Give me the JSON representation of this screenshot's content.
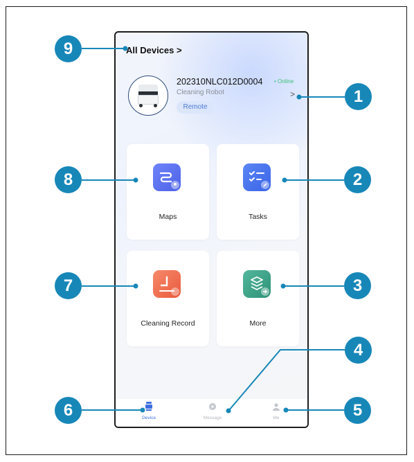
{
  "header": {
    "all_devices_label": "All Devices >"
  },
  "device": {
    "name": "202310NLC012D0004",
    "status": "• Online",
    "type": "Cleaning Robot",
    "remote_label": "Remote",
    "chevron": ">"
  },
  "cards": [
    {
      "label": "Maps",
      "icon": "map-route-icon",
      "color": "#5b6ef0"
    },
    {
      "label": "Tasks",
      "icon": "task-list-icon",
      "color": "#4a75ee"
    },
    {
      "label": "Cleaning Record",
      "icon": "clock-icon",
      "color": "#f06a4e"
    },
    {
      "label": "More",
      "icon": "layers-icon",
      "color": "#3aa58c"
    }
  ],
  "tabbar": [
    {
      "label": "Device",
      "icon": "device-icon",
      "active": true
    },
    {
      "label": "Message",
      "icon": "message-icon",
      "active": false
    },
    {
      "label": "Me",
      "icon": "person-icon",
      "active": false
    }
  ],
  "callouts": [
    "1",
    "2",
    "3",
    "4",
    "5",
    "6",
    "7",
    "8",
    "9"
  ],
  "colors": {
    "callout": "#1787b8",
    "online": "#3cc27a",
    "accent": "#4e7ad6"
  }
}
